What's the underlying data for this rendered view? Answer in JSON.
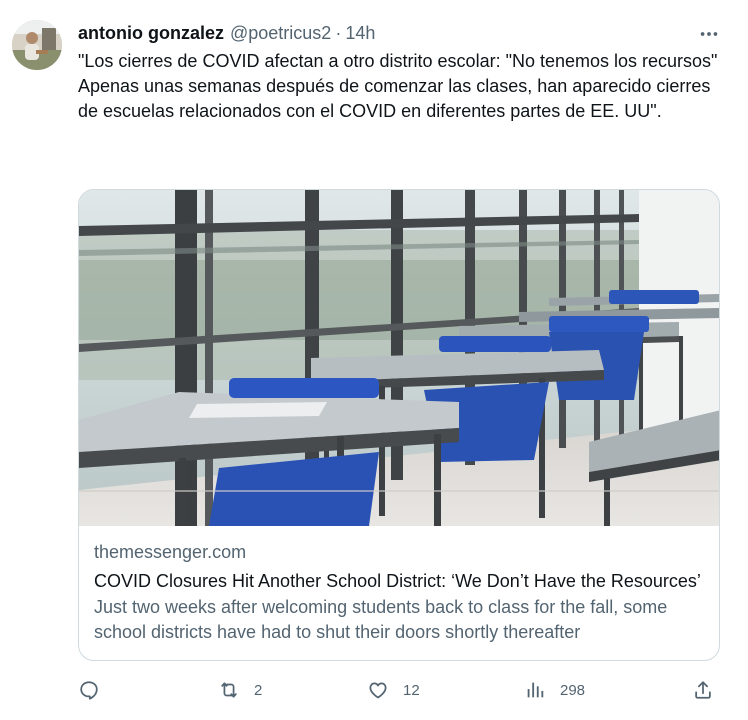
{
  "tweet": {
    "author_name": "antonio gonzalez",
    "author_handle": "@poetricus2",
    "separator": "·",
    "time": "14h",
    "text_line1": "\"Los cierres de COVID afectan a otro distrito escolar: \"No tenemos los recursos\"",
    "text_line2": "Apenas unas semanas después de comenzar las clases, han aparecido cierres de escuelas relacionados con el COVID en diferentes partes de EE. UU\"."
  },
  "card": {
    "domain": "themessenger.com",
    "title": "COVID Closures Hit Another School District: ‘We Don’t Have the Resources’",
    "description": "Just two weeks after welcoming students back to class for the fall, some school districts have had to shut their doors shortly thereafter"
  },
  "actions": {
    "replies": "",
    "retweets": "2",
    "likes": "12",
    "views": "298"
  },
  "colors": {
    "text": "#0f1419",
    "secondary": "#536471",
    "border": "#cfd9de"
  },
  "icons": {
    "more": "more-dots-icon",
    "reply": "reply-icon",
    "retweet": "retweet-icon",
    "like": "heart-icon",
    "views": "views-chart-icon",
    "share": "share-icon"
  }
}
